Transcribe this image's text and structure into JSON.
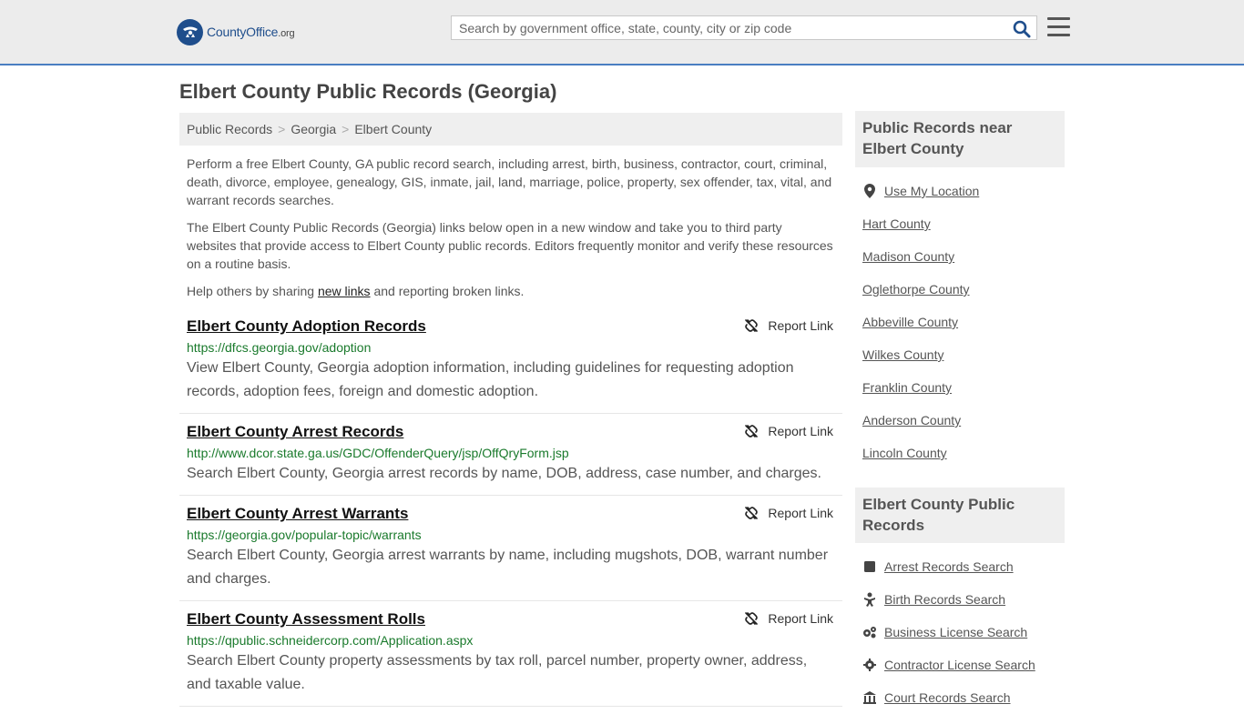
{
  "header": {
    "logo_text": "CountyOffice",
    "logo_suffix": ".org",
    "search_placeholder": "Search by government office, state, county, city or zip code"
  },
  "page_title": "Elbert County Public Records (Georgia)",
  "breadcrumb": [
    "Public Records",
    "Georgia",
    "Elbert County"
  ],
  "breadcrumb_sep": ">",
  "intro": {
    "p1": "Perform a free Elbert County, GA public record search, including arrest, birth, business, contractor, court, criminal, death, divorce, employee, genealogy, GIS, inmate, jail, land, marriage, police, property, sex offender, tax, vital, and warrant records searches.",
    "p2": "The Elbert County Public Records (Georgia) links below open in a new window and take you to third party websites that provide access to Elbert County public records. Editors frequently monitor and verify these resources on a routine basis.",
    "p3_before": "Help others by sharing ",
    "p3_link": "new links",
    "p3_after": " and reporting broken links."
  },
  "report_label": "Report Link",
  "records": [
    {
      "title": "Elbert County Adoption Records",
      "url": "https://dfcs.georgia.gov/adoption",
      "desc": "View Elbert County, Georgia adoption information, including guidelines for requesting adoption records, adoption fees, foreign and domestic adoption."
    },
    {
      "title": "Elbert County Arrest Records",
      "url": "http://www.dcor.state.ga.us/GDC/OffenderQuery/jsp/OffQryForm.jsp",
      "desc": "Search Elbert County, Georgia arrest records by name, DOB, address, case number, and charges."
    },
    {
      "title": "Elbert County Arrest Warrants",
      "url": "https://georgia.gov/popular-topic/warrants",
      "desc": "Search Elbert County, Georgia arrest warrants by name, including mugshots, DOB, warrant number and charges."
    },
    {
      "title": "Elbert County Assessment Rolls",
      "url": "https://qpublic.schneidercorp.com/Application.aspx",
      "desc": "Search Elbert County property assessments by tax roll, parcel number, property owner, address, and taxable value."
    }
  ],
  "sidebar": {
    "nearby_title": "Public Records near Elbert County",
    "use_location": "Use My Location",
    "nearby": [
      "Hart County",
      "Madison County",
      "Oglethorpe County",
      "Abbeville County",
      "Wilkes County",
      "Franklin County",
      "Anderson County",
      "Lincoln County"
    ],
    "records_title": "Elbert County Public Records",
    "records_links": [
      {
        "label": "Arrest Records Search",
        "icon": "arrest-icon"
      },
      {
        "label": "Birth Records Search",
        "icon": "baby-icon"
      },
      {
        "label": "Business License Search",
        "icon": "cogs-icon"
      },
      {
        "label": "Contractor License Search",
        "icon": "gear-icon"
      },
      {
        "label": "Court Records Search",
        "icon": "courthouse-icon"
      }
    ]
  },
  "colors": {
    "accent": "#4a7ec2",
    "link_url": "#1a7a2c",
    "header_bg": "#ececec",
    "logo": "#1f4e8c"
  }
}
